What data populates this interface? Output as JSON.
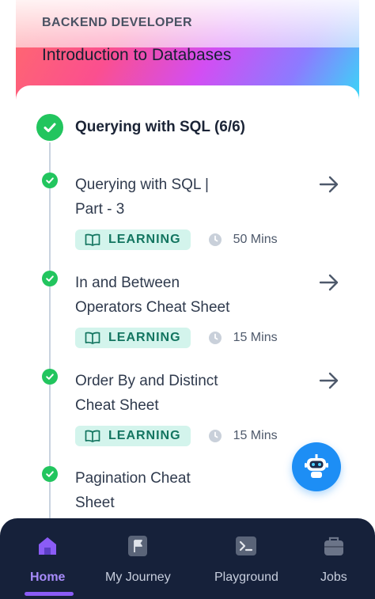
{
  "header": {
    "eyebrow": "BACKEND DEVELOPER",
    "title": "Introduction to Databases"
  },
  "section": {
    "title": "Querying with SQL (6/6)"
  },
  "items": [
    {
      "title_line1": "Querying with SQL |",
      "title_line2": "Part - 3",
      "badge": "LEARNING",
      "duration": "50 Mins"
    },
    {
      "title_line1": "In and Between",
      "title_line2": "Operators Cheat Sheet",
      "badge": "LEARNING",
      "duration": "15 Mins"
    },
    {
      "title_line1": "Order By and Distinct",
      "title_line2": "Cheat Sheet",
      "badge": "LEARNING",
      "duration": "15 Mins"
    },
    {
      "title_line1": "Pagination Cheat",
      "title_line2": "Sheet"
    }
  ],
  "nav": {
    "home": "Home",
    "journey": "My Journey",
    "playground": "Playground",
    "jobs": "Jobs"
  },
  "colors": {
    "success": "#22c55e",
    "accent": "#8b5cf6",
    "badge_bg": "#d3f4ec",
    "badge_text": "#137560",
    "nav_bg": "#16213a",
    "fab": "#1d8ef5"
  },
  "icons": {
    "completed": "check-circle-icon",
    "open": "arrow-right-icon",
    "learning": "book-open-icon",
    "duration": "clock-icon",
    "assistant": "robot-icon",
    "home": "home-icon",
    "journey": "flag-icon",
    "playground": "terminal-icon",
    "jobs": "briefcase-icon"
  }
}
